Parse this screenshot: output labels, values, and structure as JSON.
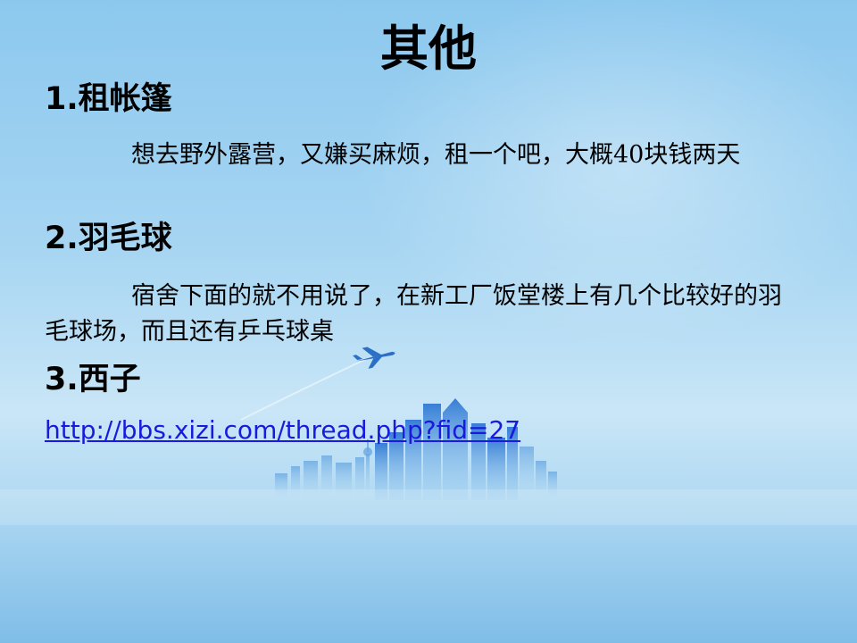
{
  "slide": {
    "title": "其他",
    "sections": [
      {
        "heading": "1.租帐篷",
        "body": "想去野外露营，又嫌买麻烦，租一个吧，大概40块钱两天"
      },
      {
        "heading": "2.羽毛球",
        "body": "宿舍下面的就不用说了，在新工厂饭堂楼上有几个比较好的羽毛球场，而且还有乒乓球桌"
      },
      {
        "heading": "3.西子",
        "link": "http://bbs.xizi.com/thread.php?fid=27"
      }
    ]
  },
  "colors": {
    "link": "#1a1adf",
    "sky_top": "#8cc8ee",
    "skyline": "#3f86d8"
  },
  "decor_icons": [
    "airplane-icon",
    "city-skyline-illustration"
  ]
}
